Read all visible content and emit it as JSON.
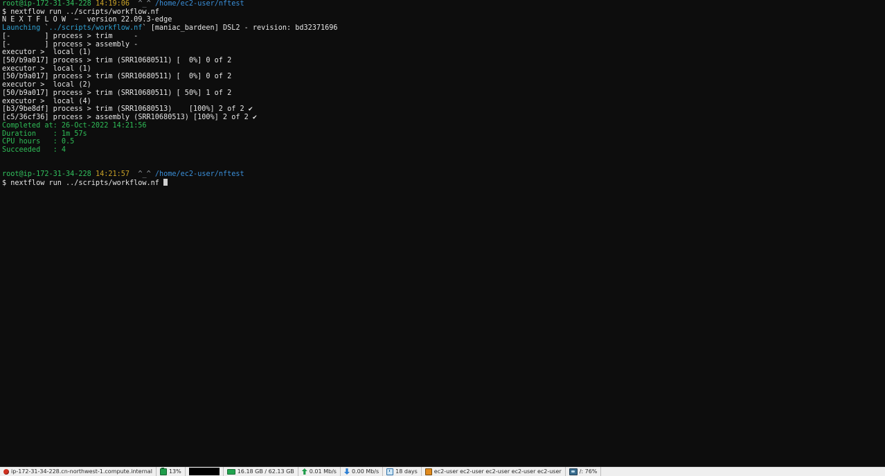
{
  "terminal": {
    "background": "#0d0d0d",
    "lines": [
      {
        "id": "prompt-line-top",
        "segments": [
          {
            "text": "root@ip-172-31-34-228",
            "color": "green"
          },
          {
            "text": " ",
            "color": "white"
          },
          {
            "text": "14:19:06",
            "color": "orange"
          },
          {
            "text": "  ",
            "color": "white"
          },
          {
            "text": "^_^",
            "color": "gray"
          },
          {
            "text": " ",
            "color": "white"
          },
          {
            "text": "/home/ec2-user/nftest",
            "color": "blue"
          }
        ]
      },
      {
        "id": "command-line-top",
        "segments": [
          {
            "text": "$ nextflow run ../scripts/workflow.nf",
            "color": "white"
          }
        ]
      },
      {
        "id": "nextflow-version",
        "segments": [
          {
            "text": "N E X T F L O W  ~  version 22.09.3-edge",
            "color": "white"
          }
        ]
      },
      {
        "id": "launching-line",
        "segments": [
          {
            "text": "Launching",
            "color": "cyan"
          },
          {
            "text": " `",
            "color": "white"
          },
          {
            "text": "../scripts/workflow.nf",
            "color": "cyan"
          },
          {
            "text": "` [maniac_bardeen] DSL2 - revision: bd32371696",
            "color": "white"
          }
        ]
      },
      {
        "id": "process-trim-pending",
        "segments": [
          {
            "text": "[-        ] process > trim     -",
            "color": "white"
          }
        ]
      },
      {
        "id": "process-assembly-pending",
        "segments": [
          {
            "text": "[-        ] process > assembly -",
            "color": "white"
          }
        ]
      },
      {
        "id": "executor-local-1a",
        "segments": [
          {
            "text": "executor >  local (1)",
            "color": "white"
          }
        ]
      },
      {
        "id": "trim-progress-0a",
        "segments": [
          {
            "text": "[50/b9a017] process > trim (SRR10680511) [  0%] 0 of 2",
            "color": "white"
          }
        ]
      },
      {
        "id": "executor-local-1b",
        "segments": [
          {
            "text": "executor >  local (1)",
            "color": "white"
          }
        ]
      },
      {
        "id": "trim-progress-0b",
        "segments": [
          {
            "text": "[50/b9a017] process > trim (SRR10680511) [  0%] 0 of 2",
            "color": "white"
          }
        ]
      },
      {
        "id": "executor-local-2",
        "segments": [
          {
            "text": "executor >  local (2)",
            "color": "white"
          }
        ]
      },
      {
        "id": "trim-progress-50",
        "segments": [
          {
            "text": "[50/b9a017] process > trim (SRR10680511) [ 50%] 1 of 2",
            "color": "white"
          }
        ]
      },
      {
        "id": "executor-local-4",
        "segments": [
          {
            "text": "executor >  local (4)",
            "color": "white"
          }
        ]
      },
      {
        "id": "trim-progress-100",
        "segments": [
          {
            "text": "[b3/9be8df] process > trim (SRR10680513)    [100%] 2 of 2 ",
            "color": "white"
          },
          {
            "text": "✔",
            "color": "check"
          }
        ]
      },
      {
        "id": "assembly-progress-100",
        "segments": [
          {
            "text": "[c5/36cf36] process > assembly (SRR10680513) [100%] 2 of 2 ",
            "color": "white"
          },
          {
            "text": "✔",
            "color": "check"
          }
        ]
      },
      {
        "id": "completed-at",
        "segments": [
          {
            "text": "Completed at: 26-Oct-2022 14:21:56",
            "color": "green2"
          }
        ]
      },
      {
        "id": "duration",
        "segments": [
          {
            "text": "Duration    : 1m 57s",
            "color": "green2"
          }
        ]
      },
      {
        "id": "cpu-hours",
        "segments": [
          {
            "text": "CPU hours   : 0.5",
            "color": "green2"
          }
        ]
      },
      {
        "id": "succeeded",
        "segments": [
          {
            "text": "Succeeded   : 4",
            "color": "green2"
          }
        ]
      },
      {
        "id": "spacer-1",
        "segments": [
          {
            "text": " ",
            "color": "white"
          }
        ]
      },
      {
        "id": "spacer-2",
        "segments": [
          {
            "text": " ",
            "color": "white"
          }
        ]
      },
      {
        "id": "prompt-line-bottom",
        "segments": [
          {
            "text": "root@ip-172-31-34-228",
            "color": "green"
          },
          {
            "text": " ",
            "color": "white"
          },
          {
            "text": "14:21:57",
            "color": "orange"
          },
          {
            "text": "  ",
            "color": "white"
          },
          {
            "text": "^_^",
            "color": "gray"
          },
          {
            "text": " ",
            "color": "white"
          },
          {
            "text": "/home/ec2-user/nftest",
            "color": "blue"
          }
        ]
      },
      {
        "id": "command-line-bottom",
        "segments": [
          {
            "text": "$ nextflow run ../scripts/workflow.nf ",
            "color": "white"
          },
          {
            "text": "",
            "color": "white",
            "cursor": true
          }
        ]
      }
    ]
  },
  "statusbar": {
    "hostname": "ip-172-31-34-228.cn-northwest-1.compute.internal",
    "cpu_percent": "13%",
    "memory": "16.18 GB / 62.13 GB",
    "upload_speed": "0.01 Mb/s",
    "download_speed": "0.00 Mb/s",
    "uptime": "18 days",
    "users": "ec2-user  ec2-user  ec2-user  ec2-user  ec2-user",
    "disk": "/: 76%"
  }
}
